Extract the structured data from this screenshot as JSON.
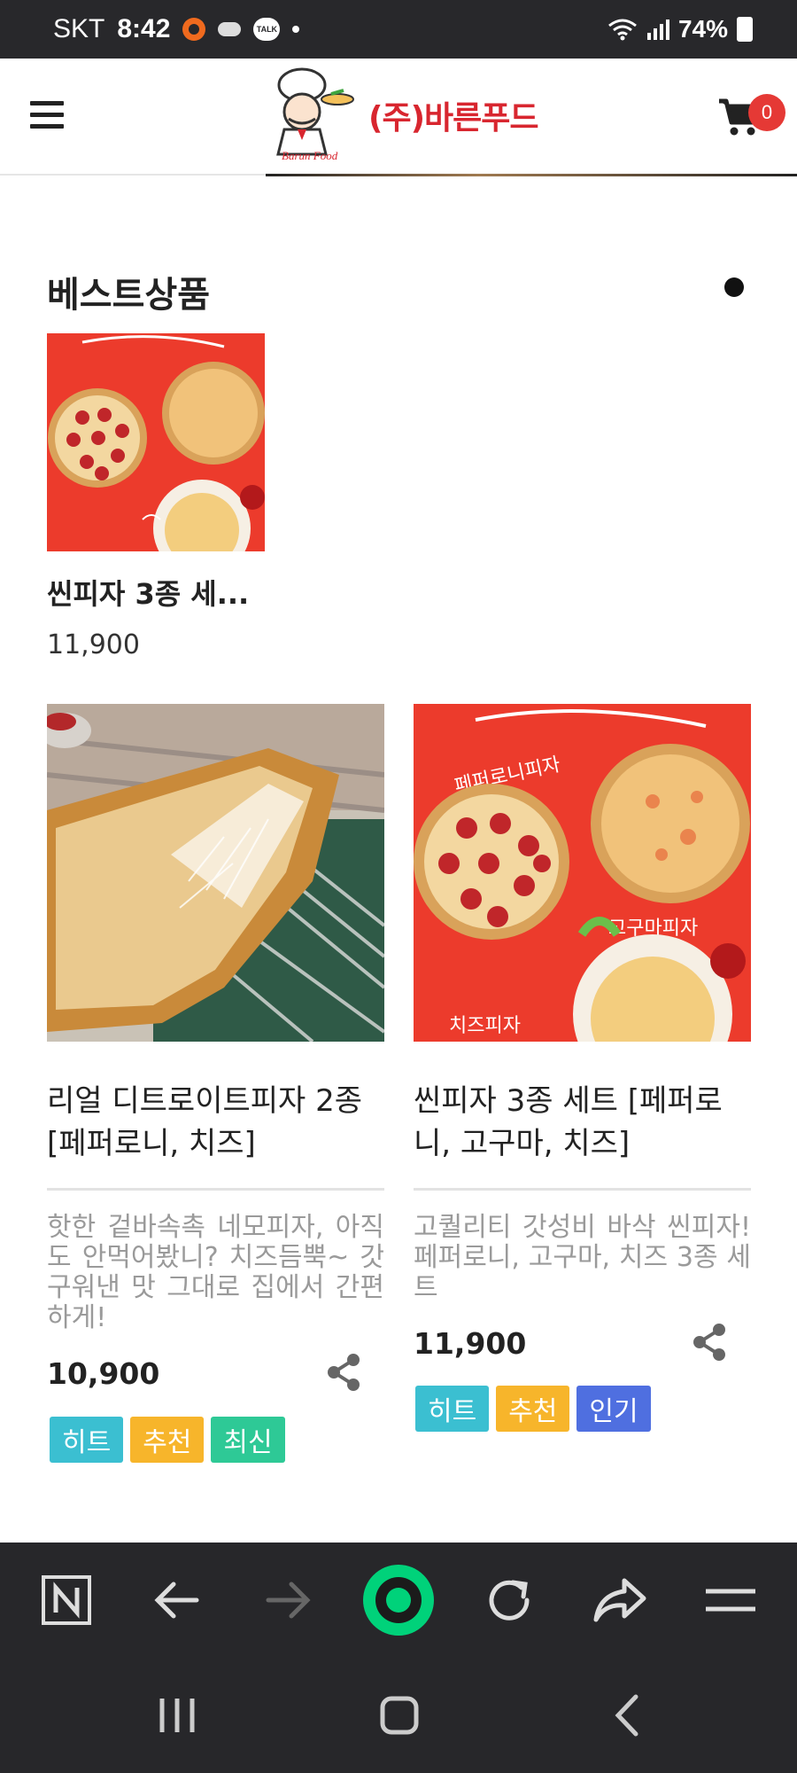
{
  "status_bar": {
    "carrier": "SKT",
    "time": "8:42",
    "talk_badge": "TALK",
    "battery": "74%"
  },
  "header": {
    "logo_text": "(주)바른푸드",
    "logo_sub": "Barun Food",
    "cart_count": "0"
  },
  "best_section": {
    "title": "베스트상품",
    "product": {
      "name": "씬피자 3종 세...",
      "price": "11,900"
    }
  },
  "cards": [
    {
      "title": "리얼 디트로이트피자 2종 [페퍼로니, 치즈]",
      "description": "핫한 겉바속촉 네모피자, 아직도 안먹어봤니? 치즈듬뿍~ 갓 구워낸 맛 그대로 집에서 간편하게!",
      "price": "10,900",
      "tags": [
        "히트",
        "추천",
        "최신"
      ]
    },
    {
      "title": "씬피자 3종 세트 [페퍼로니, 고구마, 치즈]",
      "description": "고퀄리티 갓성비 바삭 씬피자! 페퍼로니, 고구마, 치즈 3종 세트",
      "price": "11,900",
      "tags": [
        "히트",
        "추천",
        "인기"
      ]
    }
  ],
  "pizza_labels": {
    "pepperoni": "페퍼로니피자",
    "sweet_potato": "고구마피자",
    "cheese": "치즈피자"
  },
  "colors": {
    "tag_hit": "#3bbfd1",
    "tag_recommend": "#f7b52b",
    "tag_new": "#2ec996",
    "tag_popular": "#4f6fe0",
    "brand_red": "#d8262f",
    "pizza_bg": "#ec3b2c",
    "bar_bg": "#27272a",
    "naver_green": "#00d27a"
  },
  "icons": {
    "menu": "hamburger-icon",
    "cart": "cart-icon",
    "share": "share-icon",
    "browser_home": "naver-n-icon",
    "back": "back-arrow-icon",
    "forward": "forward-arrow-icon",
    "green": "naver-green-icon",
    "reload": "reload-icon",
    "share_page": "share-forward-icon",
    "menu_browser": "browser-menu-icon"
  }
}
